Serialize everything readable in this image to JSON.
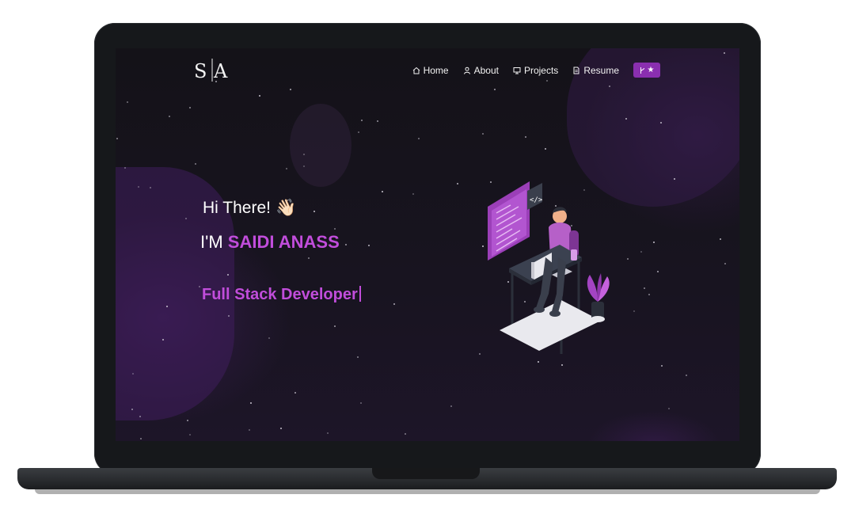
{
  "brand": {
    "logo_letters": "S|A",
    "logo_caption": "SAIDI ANASS"
  },
  "nav": {
    "items": [
      {
        "label": "Home",
        "icon": "home-icon"
      },
      {
        "label": "About",
        "icon": "user-icon"
      },
      {
        "label": "Projects",
        "icon": "projects-icon"
      },
      {
        "label": "Resume",
        "icon": "document-icon"
      }
    ],
    "cta_icons": [
      "fork-icon",
      "star-icon"
    ]
  },
  "hero": {
    "greeting": "Hi There!",
    "greeting_emoji": "👋🏻",
    "intro_prefix": "I'M ",
    "intro_name": "SAIDI ANASS",
    "typed_text": "Full Stack Developer"
  },
  "colors": {
    "accent": "#c14ddb",
    "button": "#8a2fb0",
    "background": "#141218"
  }
}
